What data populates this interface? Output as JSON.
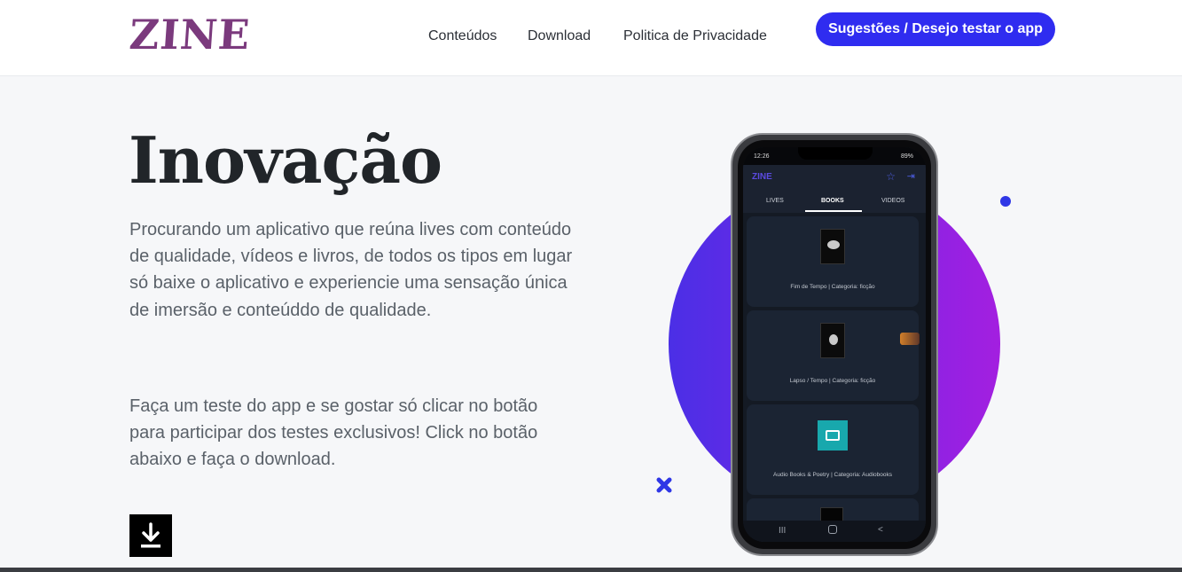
{
  "header": {
    "logo": "ZINE",
    "nav": [
      "Conteúdos",
      "Download",
      "Politica de Privacidade"
    ],
    "cta_label": "Sugestões / Desejo testar o app",
    "colors": {
      "logo": "#7b3a7d",
      "cta_bg": "#2f2cf0"
    }
  },
  "hero": {
    "title": "Inovação",
    "paragraph1": "Procurando um aplicativo que reúna lives com conteúdo de qualidade, vídeos e livros, de todos os tipos em lugar só baixe o aplicativo e experiencie uma sensação única de imersão e conteúddo de qualidade.",
    "paragraph2": "Faça um teste do app e se gostar só clicar no botão para participar dos testes exclusivos! Click no botão abaixo e faça o download.",
    "download_icon": "download-icon"
  },
  "phone": {
    "status_time": "12:26",
    "status_battery": "89%",
    "app_logo": "ZINE",
    "tabs": [
      "LIVES",
      "BOOKS",
      "VIDEOS"
    ],
    "active_tab": "BOOKS",
    "cards": [
      {
        "label": "Fim de Tempo  | Categoria:  ficção"
      },
      {
        "label": "Lapso / Tempo | Categoria:  ficção"
      },
      {
        "label": "Audio Books & Poetry | Categoria:  Audiobooks"
      },
      {
        "label": ""
      }
    ],
    "nav_buttons": [
      "III",
      "<"
    ]
  },
  "decorations": {
    "circle_gradient": [
      "#4b2fe6",
      "#a31fe0"
    ],
    "dot_color": "#2f37e6",
    "x_color": "#2f37e6"
  }
}
